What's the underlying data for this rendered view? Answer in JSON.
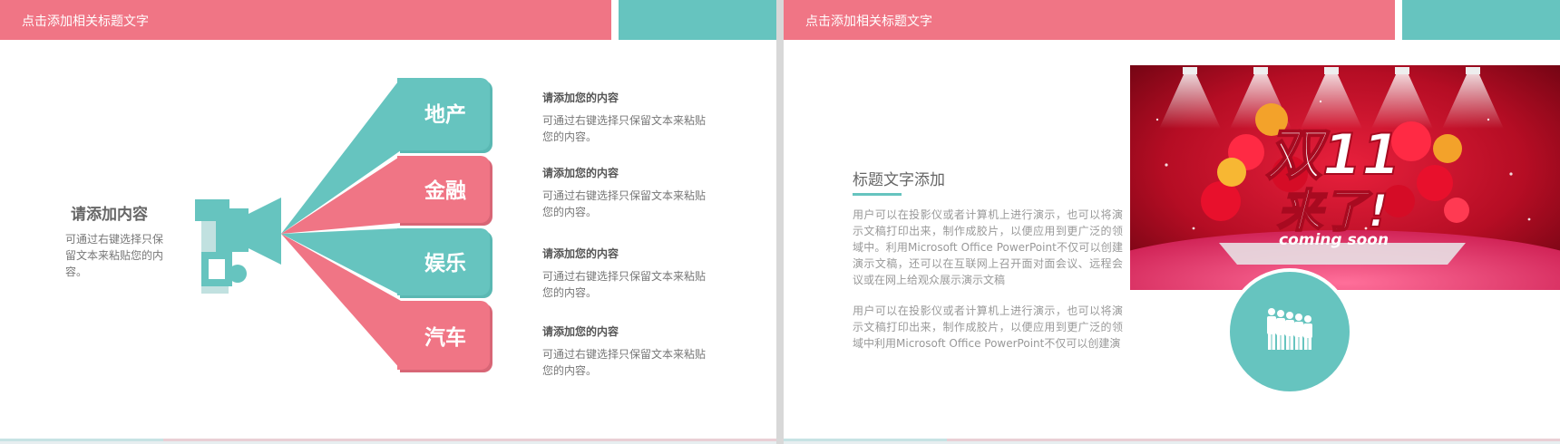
{
  "slide1": {
    "header": {
      "title": "点击添加相关标题文字"
    },
    "left": {
      "title": "请添加内容",
      "body": "可通过右键选择只保留文本来粘贴您的内容。"
    },
    "tabs": [
      {
        "label": "地产",
        "color": "#66c4bf"
      },
      {
        "label": "金融",
        "color": "#f07585"
      },
      {
        "label": "娱乐",
        "color": "#66c4bf"
      },
      {
        "label": "汽车",
        "color": "#f07585"
      }
    ],
    "items": [
      {
        "title": "请添加您的内容",
        "body": "可通过右键选择只保留文本来粘贴您的内容。"
      },
      {
        "title": "请添加您的内容",
        "body": "可通过右键选择只保留文本来粘贴您的内容。"
      },
      {
        "title": "请添加您的内容",
        "body": "可通过右键选择只保留文本来粘贴您的内容。"
      },
      {
        "title": "请添加您的内容",
        "body": "可通过右键选择只保留文本来粘贴您的内容。"
      }
    ],
    "icon": "megaphone-icon"
  },
  "slide2": {
    "header": {
      "title": "点击添加相关标题文字"
    },
    "title": "标题文字添加",
    "para1": "用户可以在投影仪或者计算机上进行演示，也可以将演示文稿打印出来，制作成胶片，以便应用到更广泛的领域中。利用Microsoft Office PowerPoint不仅可以创建演示文稿，还可以在互联网上召开面对面会议、远程会议或在网上给观众展示演示文稿",
    "para2": "用户可以在投影仪或者计算机上进行演示，也可以将演示文稿打印出来，制作成胶片，以便应用到更广泛的领域中利用Microsoft Office PowerPoint不仅可以创建演",
    "promo": {
      "line1": "双11",
      "line2": "来了!",
      "line3": "coming soon"
    },
    "icon": "people-group-icon"
  },
  "colors": {
    "pink": "#f07585",
    "teal": "#66c4bf"
  }
}
